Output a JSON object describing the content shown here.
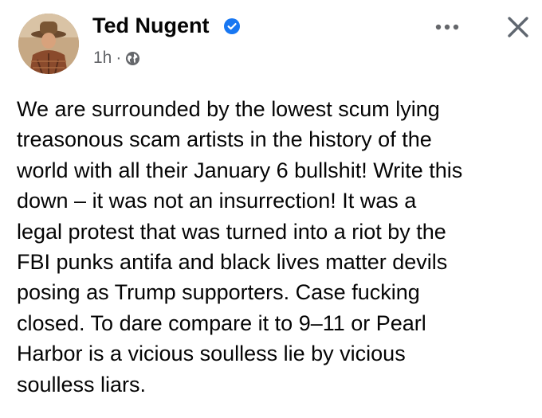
{
  "post": {
    "author": "Ted Nugent",
    "verified": true,
    "time": "1h",
    "separator": "·",
    "audience_icon": "globe-icon",
    "more_icon": "more-options-icon",
    "close_icon": "close-icon",
    "text_lines": [
      "We are surrounded by the lowest scum lying",
      "treasonous scam artists in the history of the",
      "world with all their January 6 bullshit! Write this",
      "down – it was not an insurrection! It was a",
      "legal protest that was turned into a riot by the",
      "FBI punks antifa and black lives matter devils",
      "posing as Trump supporters. Case fucking",
      "closed. To dare compare it to 9–11 or Pearl",
      "Harbor is a vicious soulless lie by vicious",
      "soulless liars."
    ]
  },
  "colors": {
    "text": "#050505",
    "secondary_text": "#65676b",
    "verified_badge": "#1877f2",
    "icon_gray": "#65676b"
  }
}
